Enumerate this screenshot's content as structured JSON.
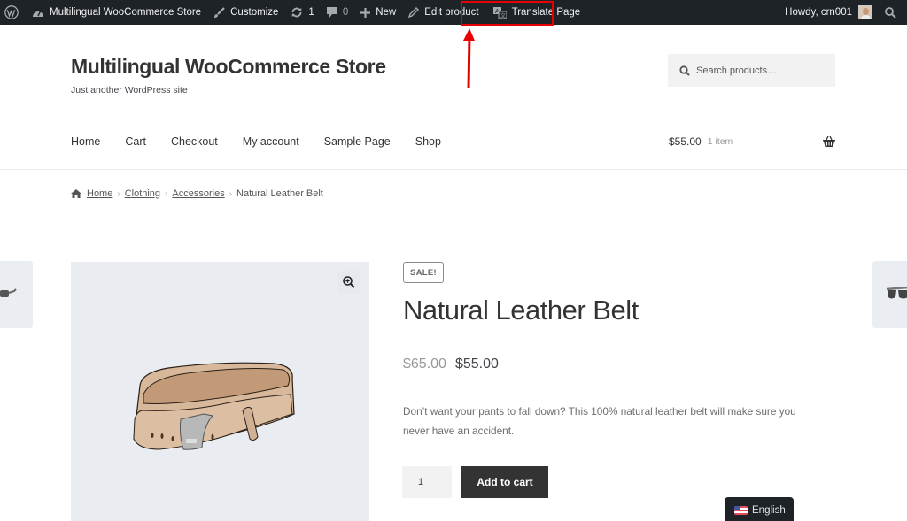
{
  "adminbar": {
    "wp_logo": "wordpress-logo-icon",
    "site_name": "Multilingual WooCommerce Store",
    "customize": "Customize",
    "updates_count": "1",
    "comments_count": "0",
    "new": "New",
    "edit_product": "Edit product",
    "translate_page": "Translate Page",
    "howdy": "Howdy, crn001",
    "highlight_color": "#e60000"
  },
  "header": {
    "site_title": "Multilingual WooCommerce Store",
    "site_description": "Just another WordPress site",
    "search_placeholder": "Search products…"
  },
  "nav": {
    "items": [
      "Home",
      "Cart",
      "Checkout",
      "My account",
      "Sample Page",
      "Shop"
    ]
  },
  "cart": {
    "total": "$55.00",
    "count": "1 item"
  },
  "breadcrumb": {
    "items": [
      "Home",
      "Clothing",
      "Accessories"
    ],
    "current": "Natural Leather Belt"
  },
  "product": {
    "badge": "SALE!",
    "title": "Natural Leather Belt",
    "regular_price": "$65.00",
    "sale_price": "$55.00",
    "description": "Don’t want your pants to fall down? This 100% natural leather belt will make sure you never have an accident.",
    "quantity": "1",
    "add_to_cart": "Add to cart"
  },
  "language_switcher": {
    "label": "English",
    "flag": "us-flag-icon"
  }
}
